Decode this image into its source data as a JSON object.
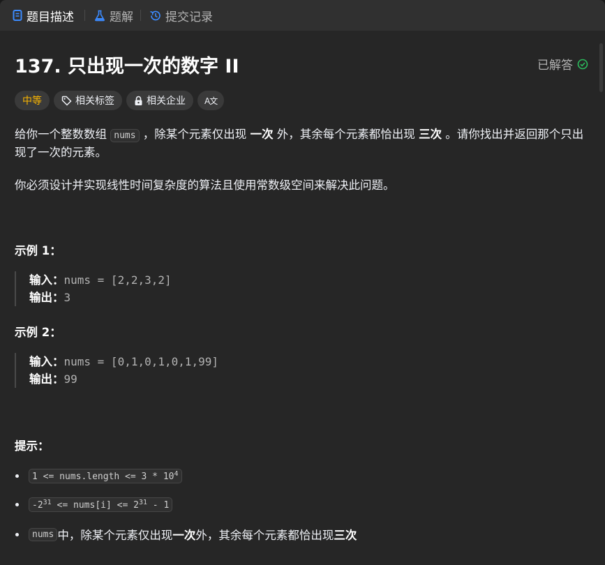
{
  "tabs": [
    {
      "label": "题目描述",
      "icon": "document-icon",
      "active": true
    },
    {
      "label": "题解",
      "icon": "flask-icon",
      "active": false
    },
    {
      "label": "提交记录",
      "icon": "history-icon",
      "active": false
    }
  ],
  "problem": {
    "title": "137. 只出现一次的数字 II",
    "status": "已解答",
    "difficulty": "中等",
    "tags_label": "相关标签",
    "companies_label": "相关企业",
    "translate_label": "A文"
  },
  "description": {
    "p1_a": "给你一个整数数组 ",
    "p1_code": "nums",
    "p1_b": " ，除某个元素仅出现 ",
    "p1_bold1": "一次",
    "p1_c": " 外，其余每个元素都恰出现 ",
    "p1_bold2": "三次",
    "p1_d": " 。请你找出并返回那个只出现了一次的元素。",
    "p2": "你必须设计并实现线性时间复杂度的算法且使用常数级空间来解决此问题。"
  },
  "examples": [
    {
      "heading": "示例 1：",
      "input_label": "输入：",
      "input": "nums = [2,2,3,2]",
      "output_label": "输出：",
      "output": "3"
    },
    {
      "heading": "示例 2：",
      "input_label": "输入：",
      "input": "nums = [0,1,0,1,0,1,99]",
      "output_label": "输出：",
      "output": "99"
    }
  ],
  "constraints": {
    "heading": "提示：",
    "c1_base": "1 <= nums.length <= 3 * 10",
    "c1_sup": "4",
    "c2_a": "-2",
    "c2_sup1": "31",
    "c2_b": " <= nums[i] <= 2",
    "c2_sup2": "31",
    "c2_c": " - 1",
    "c3_code": "nums",
    "c3_a": " 中，除某个元素仅出现 ",
    "c3_bold1": "一次",
    "c3_b": " 外，其余每个元素都恰出现 ",
    "c3_bold2": "三次"
  },
  "colors": {
    "background": "#262626",
    "tabbar": "#303030",
    "difficulty_medium": "#ffb800",
    "solved_check": "#2cbb5d",
    "tab_icon_blue": "#3c8bff"
  }
}
